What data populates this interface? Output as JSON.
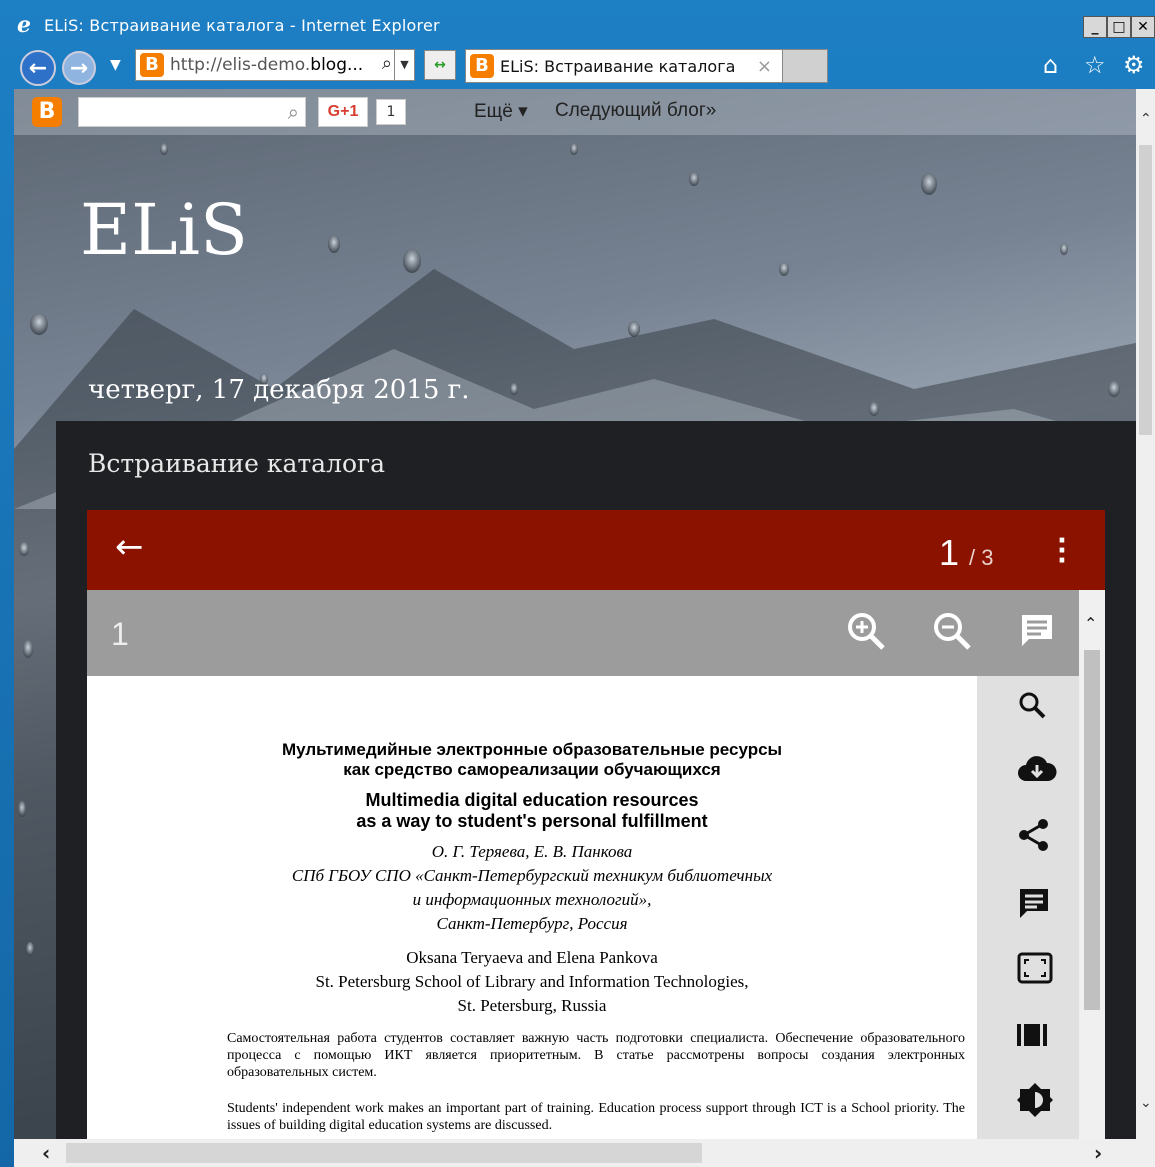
{
  "window": {
    "title": "ELiS: Встраивание каталога - Internet Explorer",
    "minimize": "_",
    "maximize": "□",
    "close": "✕"
  },
  "nav": {
    "address_prefix": "http://elis-demo.",
    "address_host": "blog...",
    "tab_title": "ELiS: Встраивание каталога",
    "tab_close": "×",
    "icons": [
      "back-icon",
      "forward-icon",
      "search-icon",
      "refresh-icon",
      "home-icon",
      "star-icon",
      "gear-icon"
    ]
  },
  "blogger_bar": {
    "logo": "B",
    "gplus": "G+1",
    "gplus_count": "1",
    "more": "Ещё ▾",
    "next_blog": "Следующий блог»"
  },
  "blog": {
    "title": "ELiS",
    "date": "четверг, 17 декабря 2015 г.",
    "post_title": "Встраивание каталога"
  },
  "reader": {
    "current_page": "1",
    "total_pages": "/ 3",
    "sub_page_number": "1",
    "sidebar_icons": [
      "search-icon",
      "cloud-download-icon",
      "share-icon",
      "comment-icon",
      "fullscreen-icon",
      "book-view-icon",
      "brightness-icon"
    ],
    "colors": {
      "header": "#8c1200",
      "toolbar": "#9c9c9c",
      "sidebar": "#e0e0e0"
    }
  },
  "document": {
    "title_ru_1": "Мультимедийные электронные образовательные ресурсы",
    "title_ru_2": "как средство самореализации обучающихся",
    "title_en_1": "Multimedia digital education resources",
    "title_en_2": "as a way to student's personal fulfillment",
    "authors_ru": "О. Г. Теряева, Е. В. Панкова",
    "org_ru_1": "СПб ГБОУ СПО «Санкт-Петербургский техникум библиотечных",
    "org_ru_2": "и информационных технологий»,",
    "city_ru": "Санкт-Петербург, Россия",
    "authors_en": "Oksana Teryaeva and Elena Pankova",
    "org_en": "St. Petersburg School of Library and Information Technologies,",
    "city_en": "St. Petersburg, Russia",
    "abstract_ru": "Самостоятельная работа студентов составляет важную часть подготовки специалиста. Обеспечение образовательного процесса с помощью ИКТ является приоритетным. В статье рассмотрены вопросы создания электронных образовательных систем.",
    "abstract_en": "Students' independent work makes an important part of training. Education process support through ICT is a School priority. The issues of building digital education systems are discussed."
  }
}
